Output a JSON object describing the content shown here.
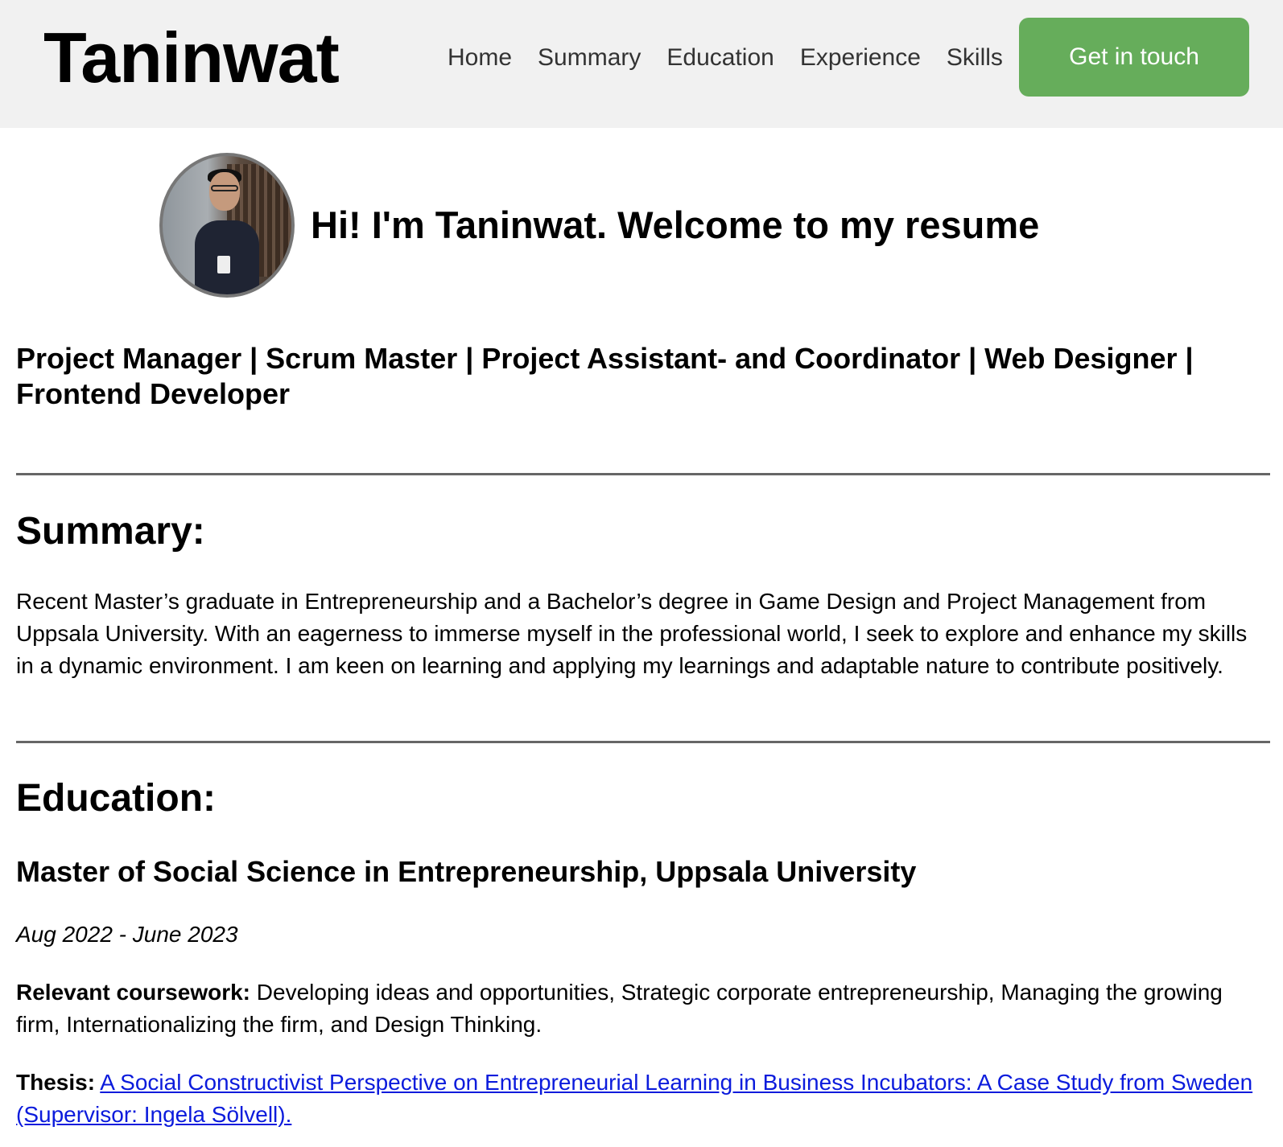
{
  "header": {
    "brand": "Taninwat",
    "nav": [
      "Home",
      "Summary",
      "Education",
      "Experience",
      "Skills"
    ],
    "cta_label": "Get in touch",
    "cta_color": "#66ad5b",
    "background": "#f1f1f1"
  },
  "hero": {
    "avatar_icon": "profile-photo",
    "heading": "Hi! I'm Taninwat. Welcome to my resume"
  },
  "tagline": "Project Manager | Scrum Master | Project Assistant- and Coordinator | Web Designer | Frontend Developer",
  "summary": {
    "title": "Summary:",
    "text": "Recent Master’s graduate in Entrepreneurship and a Bachelor’s degree in Game Design and Project Management from Uppsala University. With an eagerness to immerse myself in the professional world, I seek to explore and enhance my skills in a dynamic environment. I am keen on learning and applying my learnings and adaptable nature to contribute positively."
  },
  "education": {
    "title": "Education:",
    "degree": "Master of Social Science in Entrepreneurship, Uppsala University",
    "dates": "Aug 2022 - June 2023",
    "coursework_label": "Relevant coursework:",
    "coursework_text": " Developing ideas and opportunities, Strategic corporate entrepreneurship, Managing the growing firm, Internationalizing the firm, and Design Thinking.",
    "thesis_label": "Thesis:",
    "thesis_link": "A Social Constructivist Perspective on Entrepreneurial Learning in Business Incubators: A Case Study from Sweden",
    "supervisor_link": "(Supervisor: Ingela Sölvell).",
    "link_color": "#0b1bdc"
  }
}
